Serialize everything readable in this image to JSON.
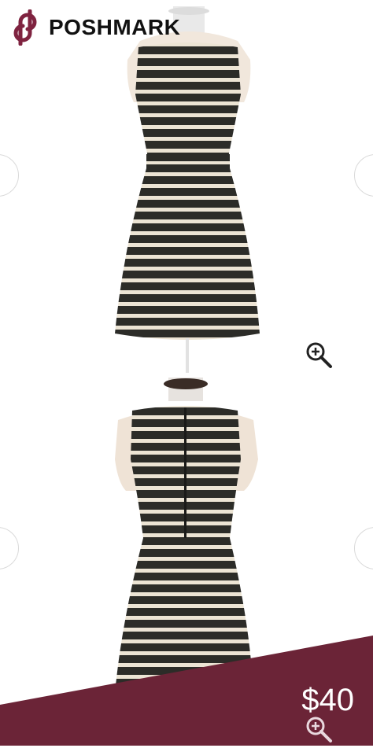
{
  "header": {
    "brand": "POSHMARK",
    "logo_icon": "poshmark-p-logo-icon"
  },
  "colors": {
    "accent": "#7f2340",
    "band": "#6b2437",
    "stripe_dark": "#2c2c28",
    "stripe_light": "#ece4d4"
  },
  "images": [
    {
      "view": "front",
      "icon": "dress-front-image"
    },
    {
      "view": "back",
      "icon": "dress-back-image"
    }
  ],
  "controls": {
    "zoom_icon": "zoom-in-icon",
    "prev_icon": "chevron-left-icon",
    "next_icon": "chevron-right-icon"
  },
  "listing": {
    "price": "$40"
  }
}
